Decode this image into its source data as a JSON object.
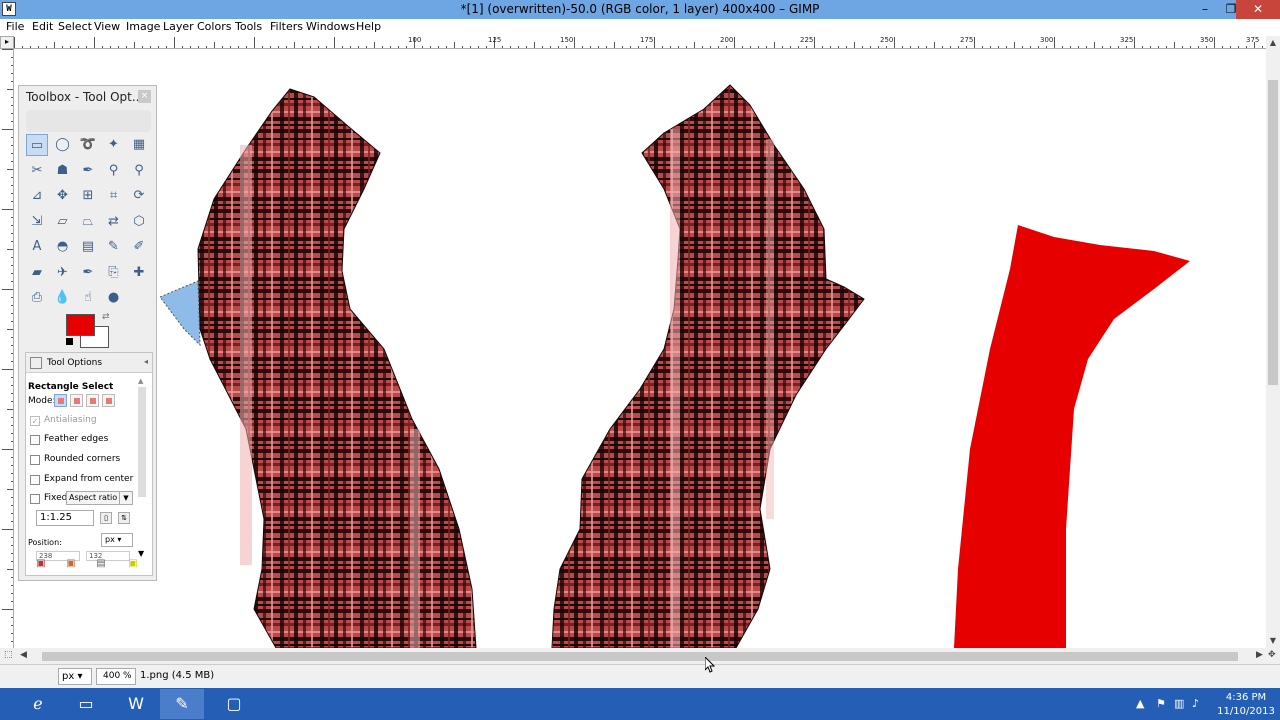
{
  "window": {
    "title": "*[1] (overwritten)-50.0 (RGB color, 1 layer) 400x400 – GIMP",
    "app_icon_label": "W",
    "minimize_glyph": "–",
    "restore_glyph": "❐",
    "close_glyph": "✕"
  },
  "menu": {
    "file": "File",
    "edit": "Edit",
    "select": "Select",
    "view": "View",
    "image": "Image",
    "layer": "Layer",
    "colors": "Colors",
    "tools": "Tools",
    "filters": "Filters",
    "windows": "Windows",
    "help": "Help"
  },
  "ruler": {
    "top_labels": [
      "100",
      "125",
      "150",
      "175",
      "200",
      "225",
      "250",
      "275",
      "300",
      "325",
      "350",
      "375"
    ]
  },
  "toolbox": {
    "title": "Toolbox - Tool Opt...",
    "close_glyph": "×",
    "colors": {
      "foreground": "#e60000",
      "background": "#ffffff"
    },
    "tool_icons": [
      "rect-select-icon",
      "ellipse-select-icon",
      "free-select-icon",
      "fuzzy-select-icon",
      "by-color-select-icon",
      "scissors-select-icon",
      "foreground-select-icon",
      "paths-icon",
      "color-picker-icon",
      "zoom-icon",
      "measure-icon",
      "move-icon",
      "align-icon",
      "crop-icon",
      "rotate-icon",
      "scale-icon",
      "shear-icon",
      "perspective-icon",
      "flip-icon",
      "cage-transform-icon",
      "text-icon",
      "bucket-fill-icon",
      "blend-icon",
      "pencil-icon",
      "paintbrush-icon",
      "eraser-icon",
      "airbrush-icon",
      "ink-icon",
      "clone-icon",
      "heal-icon",
      "perspective-clone-icon",
      "blur-icon",
      "smudge-icon",
      "dodge-burn-icon"
    ]
  },
  "tool_options": {
    "tab_label": "Tool Options",
    "tool_name": "Rectangle Select",
    "mode_label": "Mode:",
    "antialiasing": "Antialiasing",
    "feather_edges": "Feather edges",
    "rounded_corners": "Rounded corners",
    "expand_from_center": "Expand from center",
    "fixed_label": "Fixed:",
    "fixed_option": "Aspect ratio",
    "ratio_value": "1:1.25",
    "position_label": "Position:",
    "position_unit": "px",
    "position_x": "238",
    "position_y": "132"
  },
  "status": {
    "unit": "px",
    "zoom": "400 %",
    "info": "1.png (4.5 MB)"
  },
  "taskbar": {
    "time": "4:36 PM",
    "date": "11/10/2013"
  }
}
